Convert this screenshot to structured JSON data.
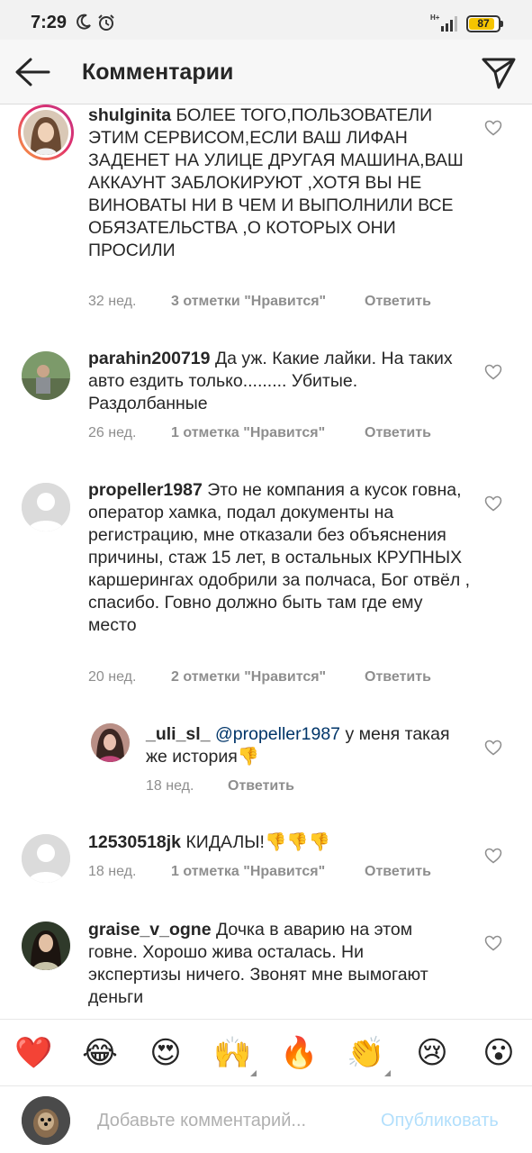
{
  "status_bar": {
    "time": "7:29",
    "network": "H+",
    "battery": "87",
    "battery_level": 0.87
  },
  "header": {
    "title": "Комментарии"
  },
  "comments": [
    {
      "username": "shulginita",
      "text": "БОЛЕЕ ТОГО,ПОЛЬЗОВАТЕЛИ ЭТИМ СЕРВИСОМ,ЕСЛИ ВАШ ЛИФАН ЗАДЕНЕТ НА УЛИЦЕ ДРУГАЯ МАШИНА,ВАШ АККАУНТ ЗАБЛОКИРУЮТ ,ХОТЯ ВЫ НЕ ВИНОВАТЫ НИ В ЧЕМ И ВЫПОЛНИЛИ ВСЕ ОБЯЗАТЕЛЬСТВА ,О КОТОРЫХ ОНИ ПРОСИЛИ",
      "time": "32 нед.",
      "likes": "3 отметки \"Нравится\"",
      "reply": "Ответить"
    },
    {
      "username": "parahin200719",
      "text": "Да уж. Какие лайки. На таких авто ездить только......... Убитые. Раздолбанные",
      "time": "26 нед.",
      "likes": "1 отметка \"Нравится\"",
      "reply": "Ответить"
    },
    {
      "username": "propeller1987",
      "text": "Это не компания а кусок говна, оператор хамка, подал документы на регистрацию, мне отказали без объяснения причины, стаж 15 лет, в остальных КРУПНЫХ каршерингах одобрили за полчаса, Бог отвёл , спасибо. Говно должно быть там где ему место",
      "time": "20 нед.",
      "likes": "2 отметки \"Нравится\"",
      "reply": "Ответить"
    },
    {
      "username": "_uli_sl_",
      "mention": "@propeller1987",
      "text": "у меня такая же история👎",
      "time": "18 нед.",
      "reply": "Ответить"
    },
    {
      "username": "12530518jk",
      "text": "КИДАЛЫ!👎👎👎",
      "time": "18 нед.",
      "likes": "1 отметка \"Нравится\"",
      "reply": "Ответить"
    },
    {
      "username": "graise_v_ogne",
      "text": "Дочка в аварию на этом говне. Хорошо жива осталась. Ни экспертизы ничего. Звонят мне вымогают деньги"
    }
  ],
  "emoji_bar": [
    "❤️",
    "😂",
    "😍",
    "🙌",
    "🔥",
    "👏",
    "😢",
    "😮"
  ],
  "composer": {
    "placeholder": "Добавьте комментарий...",
    "publish": "Опубликовать"
  },
  "colors": {
    "heart": "#e8283c",
    "link": "#003569",
    "muted": "#8e8e8e",
    "publish_disabled": "#b2dffc"
  }
}
